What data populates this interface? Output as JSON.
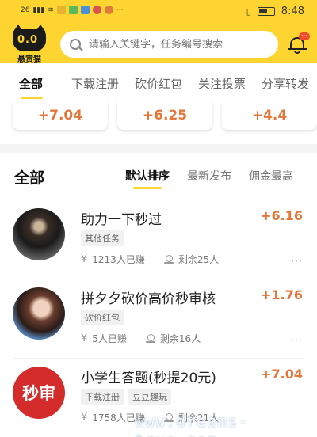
{
  "status_bar": {
    "time": "8:48",
    "network": "26"
  },
  "header": {
    "logo_eyes": "0.0",
    "logo_text": "悬赏猫",
    "search_placeholder": "请输入关键字，任务编号搜索",
    "bell_badge": "···"
  },
  "categories": [
    {
      "label": "全部",
      "active": true
    },
    {
      "label": "下载注册",
      "active": false
    },
    {
      "label": "砍价红包",
      "active": false
    },
    {
      "label": "关注投票",
      "active": false
    },
    {
      "label": "分享转发",
      "active": false
    }
  ],
  "peek_cards": [
    "+7.04",
    "+6.25",
    "+4.4"
  ],
  "list": {
    "title": "全部",
    "sort_options": [
      {
        "label": "默认排序",
        "active": true
      },
      {
        "label": "最新发布",
        "active": false
      },
      {
        "label": "佣金最高",
        "active": false
      }
    ],
    "items": [
      {
        "title": "助力一下秒过",
        "price": "+6.16",
        "tags": [
          "其他任务"
        ],
        "earned": "1213人已赚",
        "remaining": "剩余25人"
      },
      {
        "title": "拼夕夕砍价高价秒审核",
        "price": "+1.76",
        "tags": [
          "砍价红包"
        ],
        "earned": "5人已赚",
        "remaining": "剩余16人"
      },
      {
        "title": "小学生答题(秒提20元)",
        "price": "+7.04",
        "tags": [
          "下载注册",
          "豆豆趣玩"
        ],
        "earned": "1758人已赚",
        "remaining": "剩余21人",
        "avatar_text": "秒审"
      }
    ],
    "more": "···"
  },
  "watermark": "www.dreams-true.com",
  "colors": {
    "brand_yellow": "#fed430",
    "price_orange": "#e4763a"
  }
}
